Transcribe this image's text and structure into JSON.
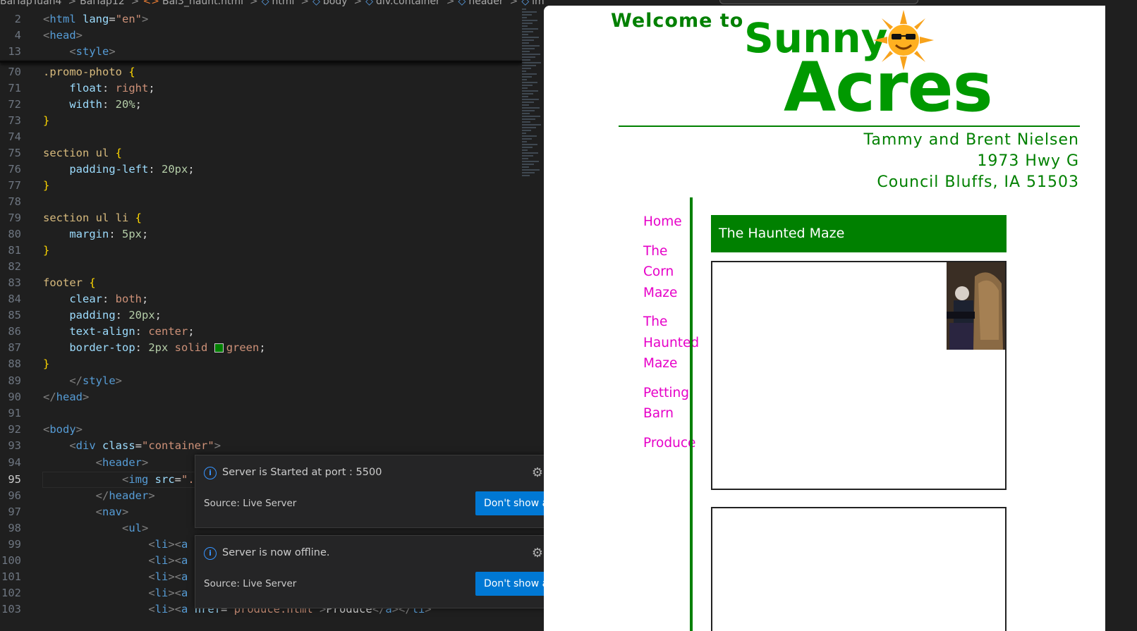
{
  "editor": {
    "breadcrumb": [
      "BaiTapTuan4",
      "BaiTap12",
      "Bai3_haunt.html",
      "html",
      "body",
      "div.container",
      "header",
      "img"
    ],
    "lines": [
      {
        "n": "2",
        "parts": [
          [
            "t-tag",
            "<"
          ],
          [
            "t-name",
            "html"
          ],
          [
            "t-plain",
            " "
          ],
          [
            "t-attr",
            "lang"
          ],
          [
            "t-plain",
            "="
          ],
          [
            "t-str",
            "\"en\""
          ],
          [
            "t-tag",
            ">"
          ]
        ]
      },
      {
        "n": "4",
        "parts": [
          [
            "t-tag",
            "<"
          ],
          [
            "t-name",
            "head"
          ],
          [
            "t-tag",
            ">"
          ]
        ]
      },
      {
        "n": "13",
        "parts": [
          [
            "t-plain",
            "    "
          ],
          [
            "t-tag",
            "<"
          ],
          [
            "t-name",
            "style"
          ],
          [
            "t-tag",
            ">"
          ]
        ]
      },
      {
        "n": "70",
        "parts": [
          [
            "t-sel",
            ".promo-photo"
          ],
          [
            "t-plain",
            " "
          ],
          [
            "t-br",
            "{"
          ]
        ]
      },
      {
        "n": "71",
        "parts": [
          [
            "t-plain",
            "    "
          ],
          [
            "t-prop",
            "float"
          ],
          [
            "t-plain",
            ": "
          ],
          [
            "t-val",
            "right"
          ],
          [
            "t-plain",
            ";"
          ]
        ]
      },
      {
        "n": "72",
        "parts": [
          [
            "t-plain",
            "    "
          ],
          [
            "t-prop",
            "width"
          ],
          [
            "t-plain",
            ": "
          ],
          [
            "t-num",
            "20%"
          ],
          [
            "t-plain",
            ";"
          ]
        ]
      },
      {
        "n": "73",
        "parts": [
          [
            "t-br",
            "}"
          ]
        ]
      },
      {
        "n": "74",
        "parts": []
      },
      {
        "n": "75",
        "parts": [
          [
            "t-sel",
            "section ul"
          ],
          [
            "t-plain",
            " "
          ],
          [
            "t-br",
            "{"
          ]
        ]
      },
      {
        "n": "76",
        "parts": [
          [
            "t-plain",
            "    "
          ],
          [
            "t-prop",
            "padding-left"
          ],
          [
            "t-plain",
            ": "
          ],
          [
            "t-num",
            "20px"
          ],
          [
            "t-plain",
            ";"
          ]
        ]
      },
      {
        "n": "77",
        "parts": [
          [
            "t-br",
            "}"
          ]
        ]
      },
      {
        "n": "78",
        "parts": []
      },
      {
        "n": "79",
        "parts": [
          [
            "t-sel",
            "section ul li"
          ],
          [
            "t-plain",
            " "
          ],
          [
            "t-br",
            "{"
          ]
        ]
      },
      {
        "n": "80",
        "parts": [
          [
            "t-plain",
            "    "
          ],
          [
            "t-prop",
            "margin"
          ],
          [
            "t-plain",
            ": "
          ],
          [
            "t-num",
            "5px"
          ],
          [
            "t-plain",
            ";"
          ]
        ]
      },
      {
        "n": "81",
        "parts": [
          [
            "t-br",
            "}"
          ]
        ]
      },
      {
        "n": "82",
        "parts": []
      },
      {
        "n": "83",
        "parts": [
          [
            "t-sel",
            "footer"
          ],
          [
            "t-plain",
            " "
          ],
          [
            "t-br",
            "{"
          ]
        ]
      },
      {
        "n": "84",
        "parts": [
          [
            "t-plain",
            "    "
          ],
          [
            "t-prop",
            "clear"
          ],
          [
            "t-plain",
            ": "
          ],
          [
            "t-val",
            "both"
          ],
          [
            "t-plain",
            ";"
          ]
        ]
      },
      {
        "n": "85",
        "parts": [
          [
            "t-plain",
            "    "
          ],
          [
            "t-prop",
            "padding"
          ],
          [
            "t-plain",
            ": "
          ],
          [
            "t-num",
            "20px"
          ],
          [
            "t-plain",
            ";"
          ]
        ]
      },
      {
        "n": "86",
        "parts": [
          [
            "t-plain",
            "    "
          ],
          [
            "t-prop",
            "text-align"
          ],
          [
            "t-plain",
            ": "
          ],
          [
            "t-val",
            "center"
          ],
          [
            "t-plain",
            ";"
          ]
        ]
      },
      {
        "n": "87",
        "parts": [
          [
            "t-plain",
            "    "
          ],
          [
            "t-prop",
            "border-top"
          ],
          [
            "t-plain",
            ": "
          ],
          [
            "t-num",
            "2px"
          ],
          [
            "t-plain",
            " "
          ],
          [
            "t-val",
            "solid"
          ],
          [
            "t-plain",
            " "
          ],
          [
            "swatch",
            "■"
          ],
          [
            "t-val",
            "green"
          ],
          [
            "t-plain",
            ";"
          ]
        ]
      },
      {
        "n": "88",
        "parts": [
          [
            "t-br",
            "}"
          ]
        ]
      },
      {
        "n": "89",
        "parts": [
          [
            "t-plain",
            "    "
          ],
          [
            "t-tag",
            "</"
          ],
          [
            "t-name",
            "style"
          ],
          [
            "t-tag",
            ">"
          ]
        ]
      },
      {
        "n": "90",
        "parts": [
          [
            "t-tag",
            "</"
          ],
          [
            "t-name",
            "head"
          ],
          [
            "t-tag",
            ">"
          ]
        ]
      },
      {
        "n": "91",
        "parts": []
      },
      {
        "n": "92",
        "parts": [
          [
            "t-tag",
            "<"
          ],
          [
            "t-name",
            "body"
          ],
          [
            "t-tag",
            ">"
          ]
        ]
      },
      {
        "n": "93",
        "parts": [
          [
            "t-plain",
            "    "
          ],
          [
            "t-tag",
            "<"
          ],
          [
            "t-name",
            "div"
          ],
          [
            "t-plain",
            " "
          ],
          [
            "t-attr",
            "class"
          ],
          [
            "t-plain",
            "="
          ],
          [
            "t-str",
            "\"container\""
          ],
          [
            "t-tag",
            ">"
          ]
        ]
      },
      {
        "n": "94",
        "parts": [
          [
            "t-plain",
            "        "
          ],
          [
            "t-tag",
            "<"
          ],
          [
            "t-name",
            "header"
          ],
          [
            "t-tag",
            ">"
          ]
        ]
      },
      {
        "n": "95",
        "parts": [
          [
            "t-plain",
            "            "
          ],
          [
            "t-tag",
            "<"
          ],
          [
            "t-name",
            "img"
          ],
          [
            "t-plain",
            " "
          ],
          [
            "t-attr",
            "src"
          ],
          [
            "t-plain",
            "="
          ],
          [
            "t-str",
            "\"."
          ]
        ]
      },
      {
        "n": "96",
        "parts": [
          [
            "t-plain",
            "        "
          ],
          [
            "t-tag",
            "</"
          ],
          [
            "t-name",
            "header"
          ],
          [
            "t-tag",
            ">"
          ]
        ]
      },
      {
        "n": "97",
        "parts": [
          [
            "t-plain",
            "        "
          ],
          [
            "t-tag",
            "<"
          ],
          [
            "t-name",
            "nav"
          ],
          [
            "t-tag",
            ">"
          ]
        ]
      },
      {
        "n": "98",
        "parts": [
          [
            "t-plain",
            "            "
          ],
          [
            "t-tag",
            "<"
          ],
          [
            "t-name",
            "ul"
          ],
          [
            "t-tag",
            ">"
          ]
        ]
      },
      {
        "n": "99",
        "parts": [
          [
            "t-plain",
            "                "
          ],
          [
            "t-tag",
            "<"
          ],
          [
            "t-name",
            "li"
          ],
          [
            "t-tag",
            "><"
          ],
          [
            "t-name",
            "a"
          ]
        ]
      },
      {
        "n": "100",
        "parts": [
          [
            "t-plain",
            "                "
          ],
          [
            "t-tag",
            "<"
          ],
          [
            "t-name",
            "li"
          ],
          [
            "t-tag",
            "><"
          ],
          [
            "t-name",
            "a"
          ]
        ]
      },
      {
        "n": "101",
        "parts": [
          [
            "t-plain",
            "                "
          ],
          [
            "t-tag",
            "<"
          ],
          [
            "t-name",
            "li"
          ],
          [
            "t-tag",
            "><"
          ],
          [
            "t-name",
            "a"
          ]
        ]
      },
      {
        "n": "102",
        "parts": [
          [
            "t-plain",
            "                "
          ],
          [
            "t-tag",
            "<"
          ],
          [
            "t-name",
            "li"
          ],
          [
            "t-tag",
            "><"
          ],
          [
            "t-name",
            "a"
          ]
        ]
      },
      {
        "n": "103",
        "parts": [
          [
            "t-plain",
            "                "
          ],
          [
            "t-tag",
            "<"
          ],
          [
            "t-name",
            "li"
          ],
          [
            "t-tag",
            "><"
          ],
          [
            "t-name",
            "a"
          ],
          [
            "t-plain",
            " "
          ],
          [
            "t-attr",
            "href"
          ],
          [
            "t-plain",
            "="
          ],
          [
            "t-str",
            "\"produce.html\""
          ],
          [
            "t-tag",
            ">"
          ],
          [
            "t-plain",
            "Produce"
          ],
          [
            "t-tag",
            "</"
          ],
          [
            "t-name",
            "a"
          ],
          [
            "t-tag",
            "></"
          ],
          [
            "t-name",
            "li"
          ],
          [
            "t-tag",
            ">"
          ]
        ]
      }
    ],
    "active_line": "95"
  },
  "notifications": [
    {
      "message": "Server is Started at port : 5500",
      "source": "Source: Live Server",
      "button": "Don't show again"
    },
    {
      "message": "Server is now offline.",
      "source": "Source: Live Server",
      "button": "Don't show again"
    }
  ],
  "site": {
    "welcome": "Welcome to",
    "sunny": "Sunny",
    "acres": "Acres",
    "address": [
      "Tammy and Brent Nielsen",
      "1973 Hwy G",
      "Council Bluffs, IA  51503"
    ],
    "nav": [
      [
        "Home"
      ],
      [
        "The",
        "Corn",
        "Maze"
      ],
      [
        "The",
        "Haunted",
        "Maze"
      ],
      [
        "Petting",
        "Barn"
      ],
      [
        "Produce"
      ]
    ],
    "section_title": "The Haunted Maze",
    "colors": {
      "green": "#008000",
      "link": "#e600c8",
      "button": "#0078d4"
    }
  }
}
